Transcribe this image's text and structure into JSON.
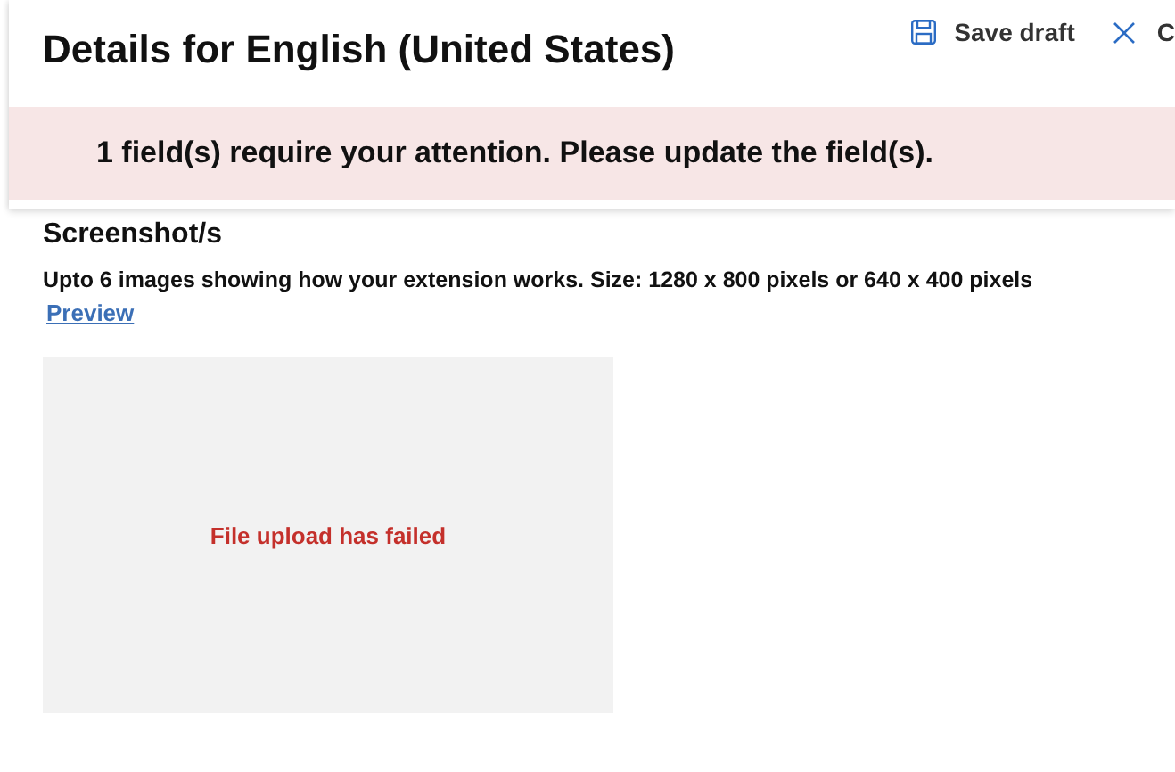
{
  "header": {
    "title": "Details for English (United States)",
    "actions": [
      {
        "kind": "save",
        "label": "Save draft"
      },
      {
        "kind": "close",
        "label": "C"
      }
    ]
  },
  "alert": {
    "message": "1 field(s) require your attention. Please update the field(s)."
  },
  "section": {
    "heading": "Screenshot/s",
    "description": "Upto 6 images showing how your extension works. Size: 1280 x 800 pixels or 640 x 400 pixels",
    "link": "Preview",
    "upload": {
      "error": "File upload has failed"
    }
  }
}
